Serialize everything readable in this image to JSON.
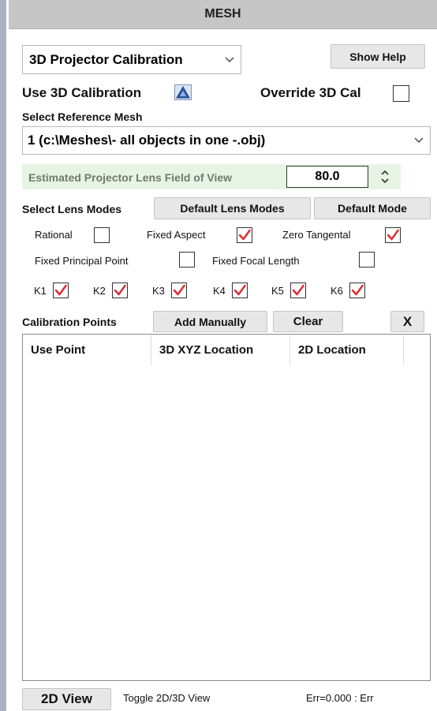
{
  "header": {
    "title": "MESH"
  },
  "mode_select": {
    "value": "3D Projector Calibration"
  },
  "show_help": {
    "label": "Show Help"
  },
  "use3d": {
    "label": "Use 3D Calibration"
  },
  "override": {
    "label": "Override 3D Cal",
    "checked": false
  },
  "reference_mesh": {
    "label": "Select Reference Mesh",
    "value": "1 (c:\\Meshes\\- all objects in one -.obj)"
  },
  "fov": {
    "label": "Estimated Projector Lens Field of View",
    "value": "80.0"
  },
  "lens_modes": {
    "label": "Select Lens Modes",
    "default_lens_modes": "Default Lens Modes",
    "default_mode": "Default Mode",
    "rational": {
      "label": "Rational",
      "checked": false
    },
    "fixed_aspect": {
      "label": "Fixed Aspect",
      "checked": true
    },
    "zero_tangental": {
      "label": "Zero Tangental",
      "checked": true
    },
    "fixed_principal_point": {
      "label": "Fixed Principal Point",
      "checked": false
    },
    "fixed_focal_length": {
      "label": "Fixed Focal Length",
      "checked": false
    },
    "k": [
      {
        "label": "K1",
        "checked": true
      },
      {
        "label": "K2",
        "checked": true
      },
      {
        "label": "K3",
        "checked": true
      },
      {
        "label": "K4",
        "checked": true
      },
      {
        "label": "K5",
        "checked": true
      },
      {
        "label": "K6",
        "checked": true
      }
    ]
  },
  "calibration_points": {
    "label": "Calibration Points",
    "add_manually": "Add Manually",
    "clear": "Clear",
    "close": "X",
    "columns": [
      "Use Point",
      "3D XYZ Location",
      "2D Location"
    ]
  },
  "footer": {
    "view_button": "2D View",
    "toggle_label": "Toggle 2D/3D View",
    "error_text": "Err=0.000 : Err"
  },
  "colors": {
    "check_red": "#e0303a",
    "fov_background": "#e6f5e3",
    "accent_blue": "#2a5caa"
  }
}
